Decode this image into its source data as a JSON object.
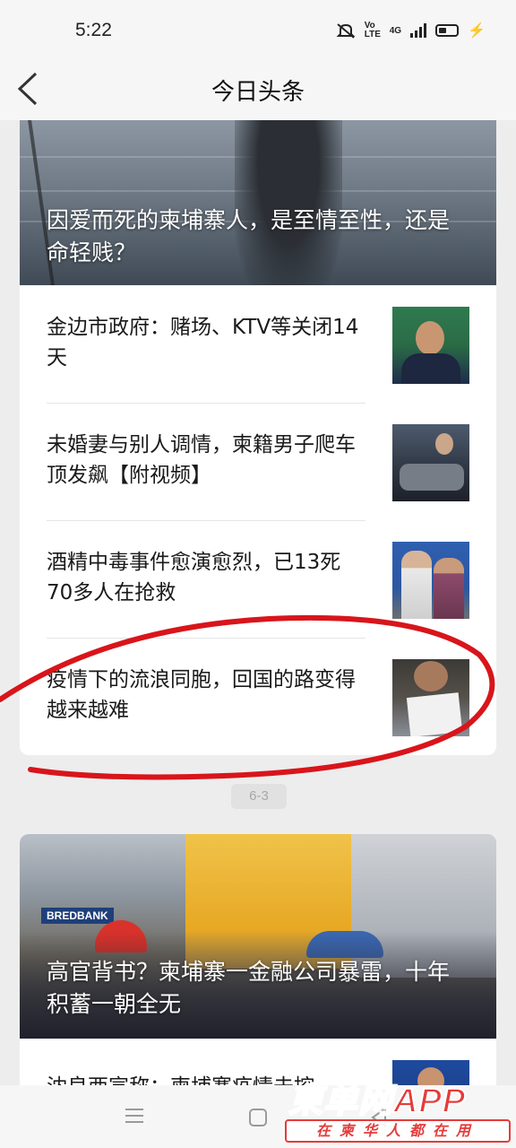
{
  "status_bar": {
    "time": "5:22",
    "network": "4G",
    "volte": "Vo LTE"
  },
  "nav": {
    "title": "今日头条",
    "back_icon": "chevron-left-icon"
  },
  "card_1": {
    "hero_title": "因爱而死的柬埔寨人，是至情至性，还是命轻贱？",
    "items": [
      {
        "title": "金边市政府：赌场、KTV等关闭14天"
      },
      {
        "title": "未婚妻与别人调情，柬籍男子爬车顶发飙【附视频】"
      },
      {
        "title": "酒精中毒事件愈演愈烈，已13死70多人在抢救"
      },
      {
        "title": "疫情下的流浪同胞，回国的路变得越来越难"
      }
    ]
  },
  "page_indicator": "6-3",
  "card_2": {
    "hero_title": "高官背书？柬埔寨一金融公司暴雷，十年积蓄一朝全无",
    "sign_text": "BREDBANK",
    "partial_item_title": "沈良西宣称：柬埔寨疫情未控"
  },
  "annotation": {
    "color": "#d8151b"
  },
  "watermark": {
    "logo": "柬单网",
    "app": "APP",
    "slogan": "在柬华人都在用",
    "color": "#e53b3b"
  },
  "bottom_nav": {
    "menu_icon": "menu-icon",
    "home_icon": "home-icon",
    "back_icon": "back-triangle-icon"
  }
}
